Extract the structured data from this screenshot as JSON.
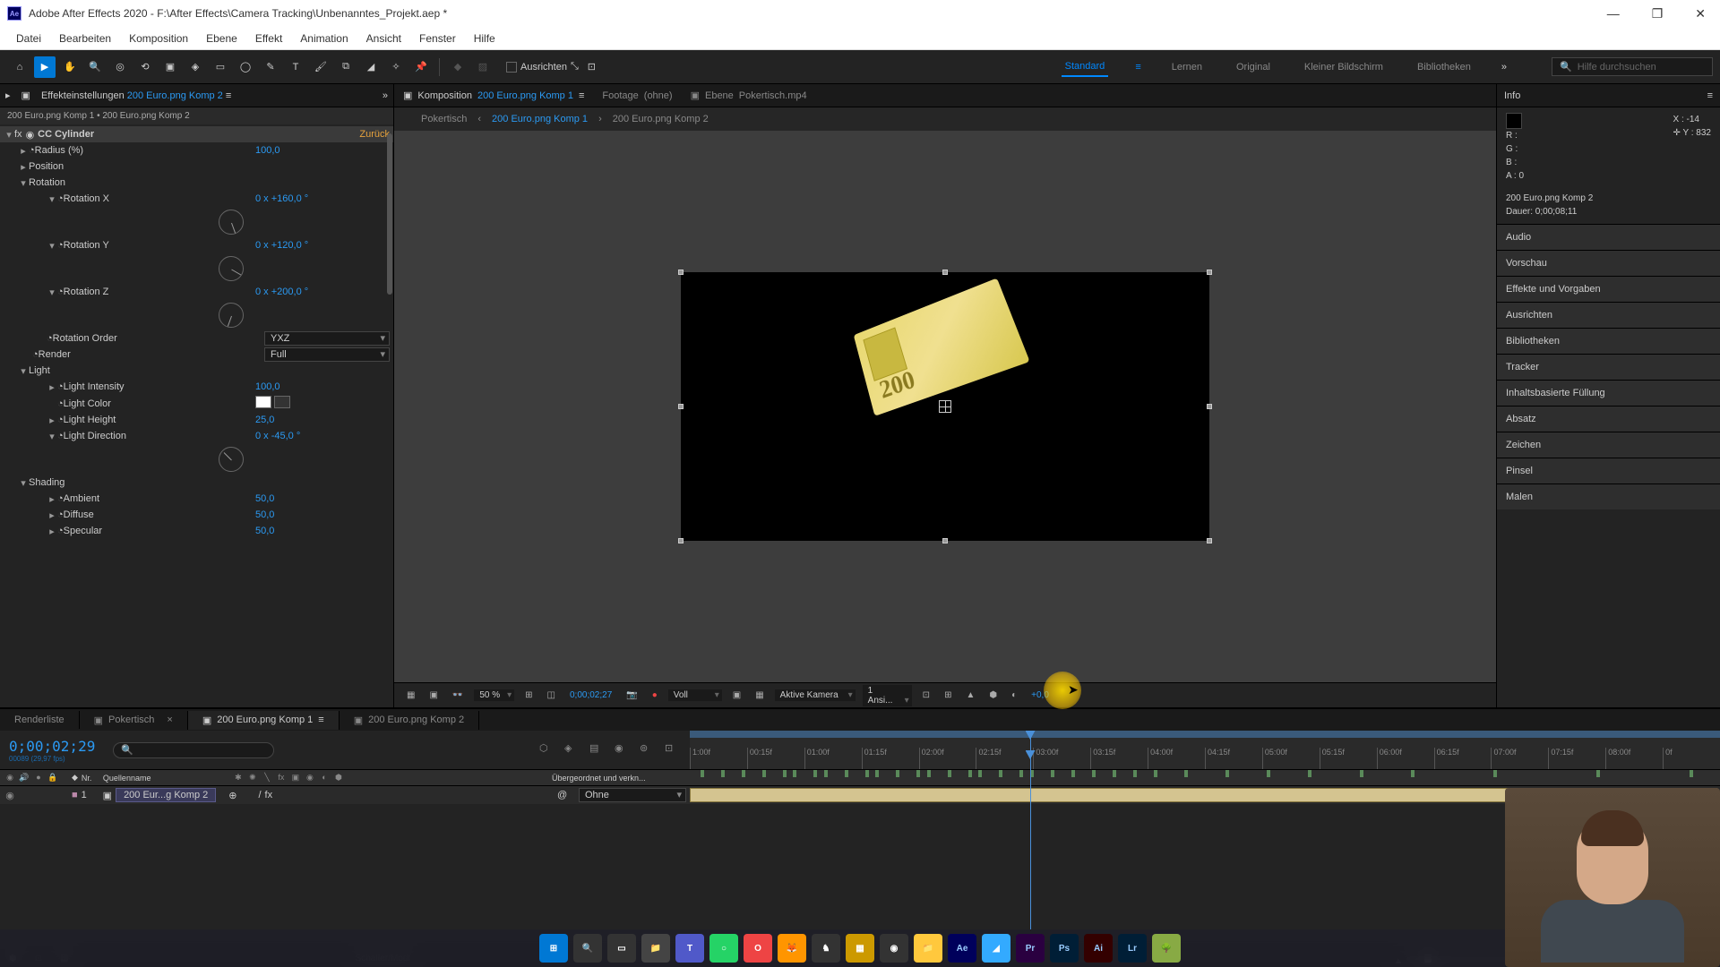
{
  "window": {
    "title": "Adobe After Effects 2020 - F:\\After Effects\\Camera Tracking\\Unbenanntes_Projekt.aep *"
  },
  "menu": [
    "Datei",
    "Bearbeiten",
    "Komposition",
    "Ebene",
    "Effekt",
    "Animation",
    "Ansicht",
    "Fenster",
    "Hilfe"
  ],
  "toolbar": {
    "ausrichten": "Ausrichten",
    "search_placeholder": "Hilfe durchsuchen"
  },
  "workspaces": [
    "Standard",
    "Lernen",
    "Original",
    "Kleiner Bildschirm",
    "Bibliotheken"
  ],
  "effect_panel": {
    "tab_label": "Effekteinstellungen",
    "tab_comp": "200 Euro.png Komp 2",
    "breadcrumb": "200 Euro.png Komp 1 • 200 Euro.png Komp 2",
    "effect_name": "CC Cylinder",
    "reset_link": "Zurück",
    "props": {
      "radius_label": "Radius (%)",
      "radius_value": "100,0",
      "position_label": "Position",
      "rotation_label": "Rotation",
      "rotx_label": "Rotation X",
      "rotx_value": "0 x +160,0 °",
      "roty_label": "Rotation Y",
      "roty_value": "0 x +120,0 °",
      "rotz_label": "Rotation Z",
      "rotz_value": "0 x +200,0 °",
      "rotorder_label": "Rotation Order",
      "rotorder_value": "YXZ",
      "render_label": "Render",
      "render_value": "Full",
      "light_label": "Light",
      "lightint_label": "Light Intensity",
      "lightint_value": "100,0",
      "lightcolor_label": "Light Color",
      "lightheight_label": "Light Height",
      "lightheight_value": "25,0",
      "lightdir_label": "Light Direction",
      "lightdir_value": "0 x -45,0 °",
      "shading_label": "Shading",
      "ambient_label": "Ambient",
      "ambient_value": "50,0",
      "diffuse_label": "Diffuse",
      "diffuse_value": "50,0",
      "specular_label": "Specular",
      "specular_value": "50,0"
    }
  },
  "comp_panel": {
    "tabs": {
      "komposition": "Komposition",
      "komposition_name": "200 Euro.png Komp 1",
      "footage": "Footage",
      "footage_val": "(ohne)",
      "ebene": "Ebene",
      "ebene_val": "Pokertisch.mp4"
    },
    "breadcrumb": [
      "Pokertisch",
      "200 Euro.png Komp 1",
      "200 Euro.png Komp 2"
    ],
    "footer": {
      "zoom": "50 %",
      "timecode": "0;00;02;27",
      "res": "Voll",
      "camera": "Aktive Kamera",
      "views": "1 Ansi...",
      "exposure": "+0,0"
    }
  },
  "info_panel": {
    "title": "Info",
    "R": "R :",
    "G": "G :",
    "B": "B :",
    "A": "A :",
    "A_val": "0",
    "X": "X : -14",
    "Y": "Y : 832",
    "layer": "200 Euro.png Komp 2",
    "dauer": "Dauer: 0;00;08;11"
  },
  "right_accordions": [
    "Audio",
    "Vorschau",
    "Effekte und Vorgaben",
    "Ausrichten",
    "Bibliotheken",
    "Tracker",
    "Inhaltsbasierte Füllung",
    "Absatz",
    "Zeichen",
    "Pinsel",
    "Malen"
  ],
  "timeline": {
    "tabs": [
      "Renderliste",
      "Pokertisch",
      "200 Euro.png Komp 1",
      "200 Euro.png Komp 2"
    ],
    "active_tab": 2,
    "timecode": "0;00;02;29",
    "timecode_sub": "00089 (29,97 fps)",
    "col_headers": {
      "nr": "Nr.",
      "quellenname": "Quellenname",
      "parent": "Übergeordnet und verkn..."
    },
    "layer": {
      "nr": "1",
      "name": "200 Eur...g Komp 2",
      "parent": "Ohne"
    },
    "ruler": [
      "1:00f",
      "00:15f",
      "01:00f",
      "01:15f",
      "02:00f",
      "02:15f",
      "03:00f",
      "03:15f",
      "04:00f",
      "04:15f",
      "05:00f",
      "05:15f",
      "06:00f",
      "06:15f",
      "07:00f",
      "07:15f",
      "08:00f",
      "0f"
    ],
    "footer": "Schalter/Modi"
  },
  "taskbar": [
    {
      "name": "start",
      "bg": "#0078d4",
      "txt": "⊞"
    },
    {
      "name": "search",
      "bg": "#333",
      "txt": "🔍"
    },
    {
      "name": "taskview",
      "bg": "#333",
      "txt": "▭"
    },
    {
      "name": "explorer",
      "bg": "#444",
      "txt": "📁"
    },
    {
      "name": "teams",
      "bg": "#5059c9",
      "txt": "T"
    },
    {
      "name": "whatsapp",
      "bg": "#25d366",
      "txt": "○"
    },
    {
      "name": "opera",
      "bg": "#e44",
      "txt": "O"
    },
    {
      "name": "firefox",
      "bg": "#ff9500",
      "txt": "🦊"
    },
    {
      "name": "app1",
      "bg": "#333",
      "txt": "♞"
    },
    {
      "name": "app2",
      "bg": "#c90",
      "txt": "▦"
    },
    {
      "name": "obs",
      "bg": "#333",
      "txt": "◉"
    },
    {
      "name": "folder",
      "bg": "#ffc83d",
      "txt": "📁"
    },
    {
      "name": "ae",
      "bg": "#00005b",
      "txt": "Ae"
    },
    {
      "name": "app3",
      "bg": "#3af",
      "txt": "◢"
    },
    {
      "name": "pr",
      "bg": "#2a0040",
      "txt": "Pr"
    },
    {
      "name": "ps",
      "bg": "#001e36",
      "txt": "Ps"
    },
    {
      "name": "ai",
      "bg": "#330000",
      "txt": "Ai"
    },
    {
      "name": "lr",
      "bg": "#001e36",
      "txt": "Lr"
    },
    {
      "name": "app4",
      "bg": "#8a4",
      "txt": "🌳"
    }
  ]
}
